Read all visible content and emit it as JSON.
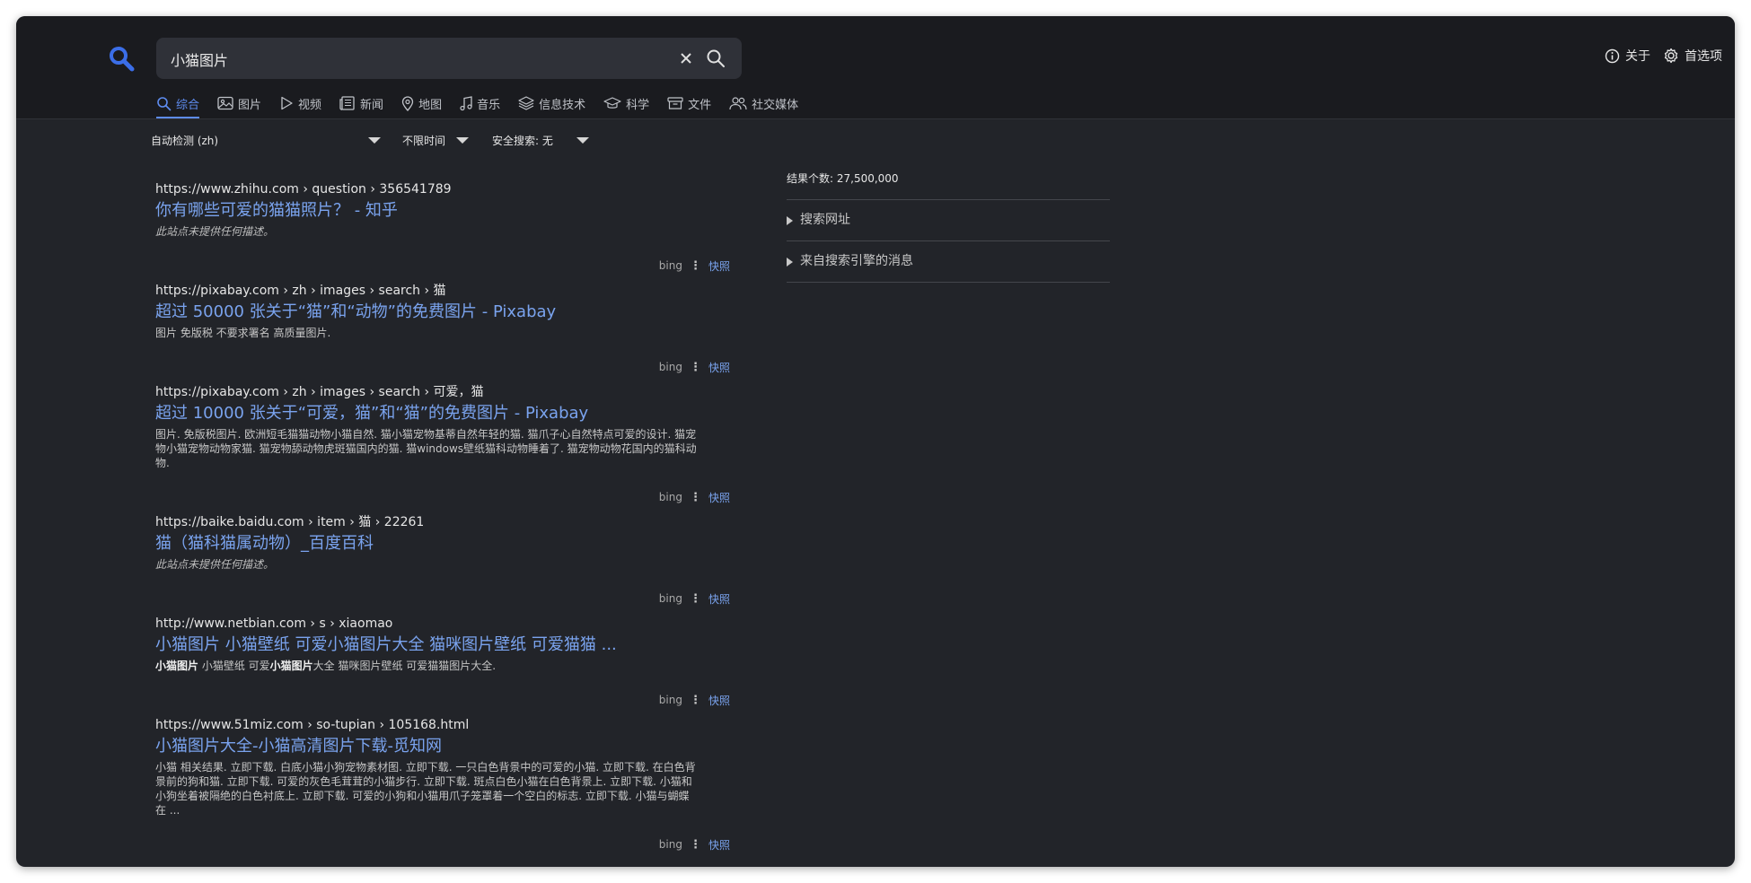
{
  "search": {
    "query": "小猫图片"
  },
  "header_links": {
    "about": "关于",
    "preferences": "首选项"
  },
  "tabs": [
    {
      "label": "综合",
      "icon": "search-icon",
      "active": true
    },
    {
      "label": "图片",
      "icon": "image-icon"
    },
    {
      "label": "视频",
      "icon": "play-icon"
    },
    {
      "label": "新闻",
      "icon": "newspaper-icon"
    },
    {
      "label": "地图",
      "icon": "map-pin-icon"
    },
    {
      "label": "音乐",
      "icon": "music-icon"
    },
    {
      "label": "信息技术",
      "icon": "layers-icon"
    },
    {
      "label": "科学",
      "icon": "graduation-cap-icon"
    },
    {
      "label": "文件",
      "icon": "archive-icon"
    },
    {
      "label": "社交媒体",
      "icon": "users-icon"
    }
  ],
  "filters": {
    "language": "自动检测 (zh)",
    "time": "不限时间",
    "safe_search": "安全搜索: 无"
  },
  "results": [
    {
      "url": "https://www.zhihu.com  › question › 356541789",
      "title": "你有哪些可爱的猫猫照片？ - 知乎",
      "desc": "此站点未提供任何描述。",
      "engine": "bing",
      "cache": "快照"
    },
    {
      "url": "https://pixabay.com  › zh › images › search › 猫",
      "title": "超过 50000 张关于“猫”和“动物”的免费图片 - Pixabay",
      "desc": "图片 免版税 不要求署名 高质量图片.",
      "engine": "bing",
      "cache": "快照"
    },
    {
      "url": "https://pixabay.com  › zh › images › search › 可爱，猫",
      "title": "超过 10000 张关于“可爱，猫”和“猫”的免费图片 - Pixabay",
      "desc": "图片. 免版税图片. 欧洲短毛猫猫动物小猫自然. 猫小猫宠物基蒂自然年轻的猫. 猫爪子心自然特点可爱的设计. 猫宠物小猫宠物动物家猫. 猫宠物舔动物虎斑猫国内的猫. 猫windows壁纸猫科动物睡着了. 猫宠物动物花国内的猫科动物.",
      "engine": "bing",
      "cache": "快照"
    },
    {
      "url": "https://baike.baidu.com  › item › 猫 › 22261",
      "title": "猫（猫科猫属动物）_百度百科",
      "desc": "此站点未提供任何描述。",
      "engine": "bing",
      "cache": "快照"
    },
    {
      "url": "http://www.netbian.com  › s › xiaomao",
      "title": "小猫图片 小猫壁纸 可爱小猫图片大全 猫咪图片壁纸 可爱猫猫 ...",
      "desc_parts": {
        "b1": "小猫图片",
        "t1": " 小猫壁纸 可爱",
        "b2": "小猫图片",
        "t2": "大全 猫咪图片壁纸 可爱猫猫图片大全."
      },
      "engine": "bing",
      "cache": "快照"
    },
    {
      "url": "https://www.51miz.com  › so-tupian › 105168.html",
      "title": "小猫图片大全-小猫高清图片下载-觅知网",
      "desc": "小猫 相关结果. 立即下载. 白底小猫小狗宠物素材图. 立即下载. 一只白色背景中的可爱的小猫. 立即下载. 在白色背景前的狗和猫. 立即下载. 可爱的灰色毛茸茸的小猫步行. 立即下载. 斑点白色小猫在白色背景上. 立即下载. 小猫和小狗坐着被隔绝的白色衬底上. 立即下载. 可爱的小狗和小猫用爪子笼罩着一个空白的标志. 立即下载. 小猫与蝴蝶在 ...",
      "engine": "bing",
      "cache": "快照"
    }
  ],
  "sidebar": {
    "count_label": "结果个数: 27,500,000",
    "items": [
      {
        "label": "搜索网址"
      },
      {
        "label": "来自搜索引擎的消息"
      }
    ]
  },
  "colors": {
    "accent": "#5e8cf0",
    "link": "#7aa3ee",
    "logo": "#3b6ee8"
  }
}
